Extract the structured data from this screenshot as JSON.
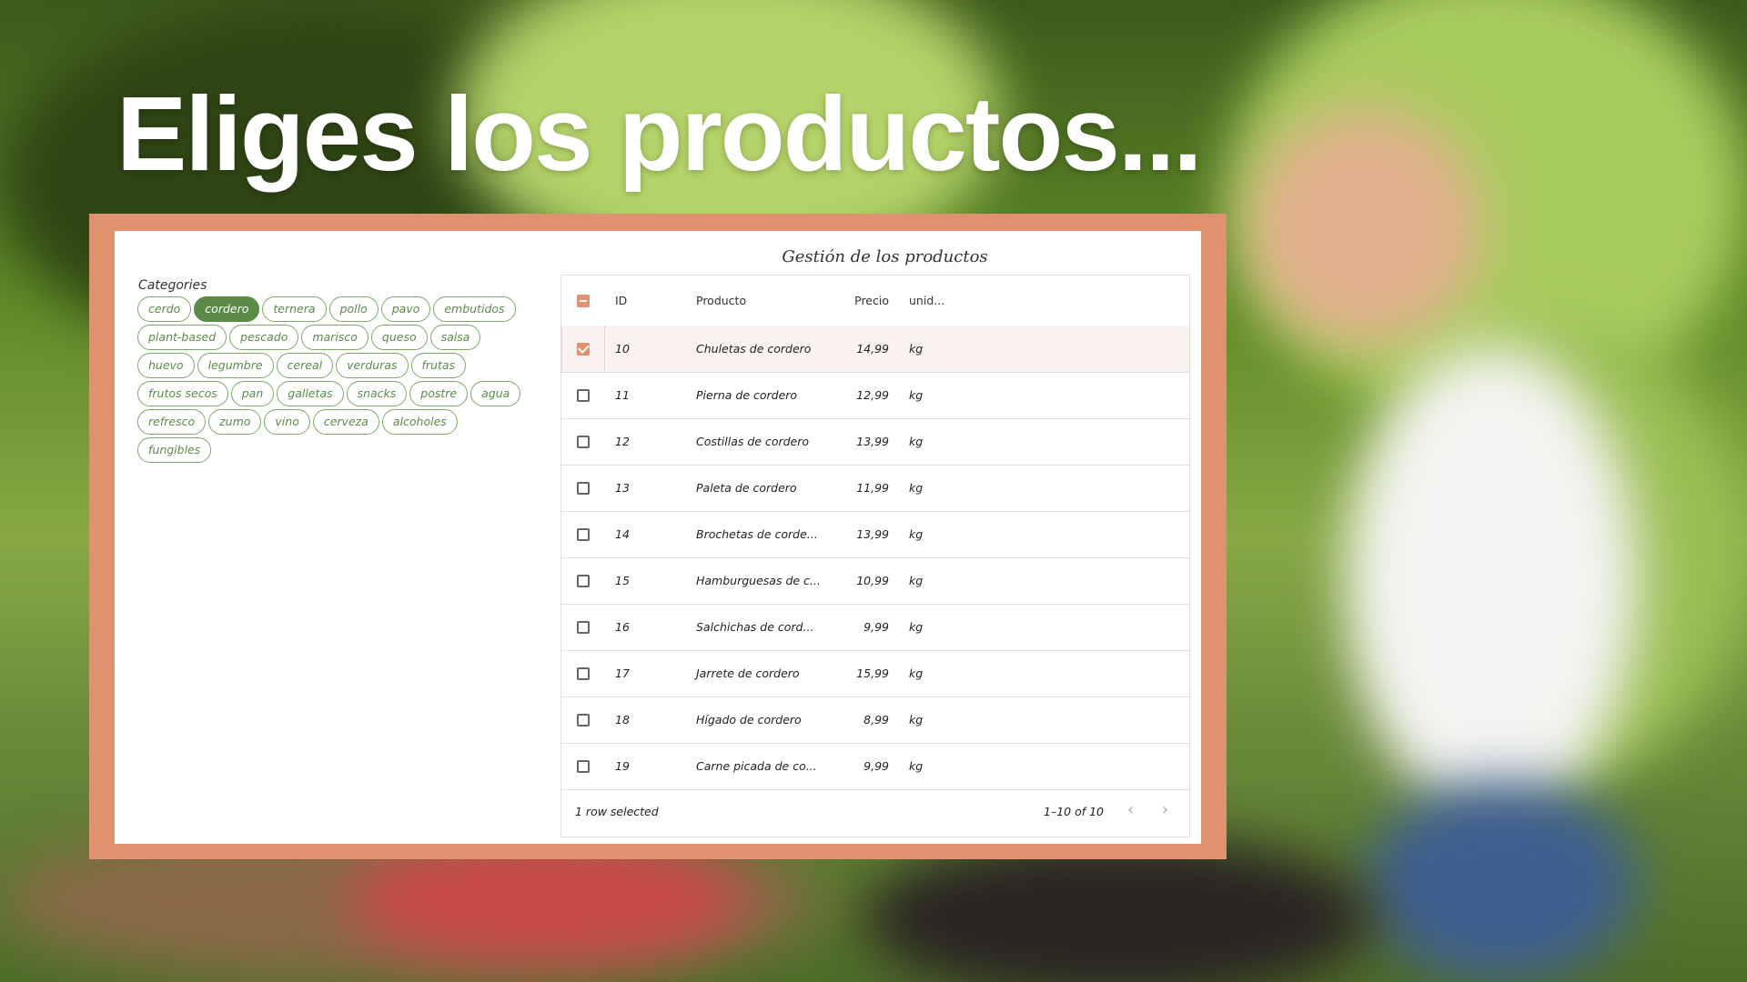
{
  "headline": "Eliges los productos...",
  "panel": {
    "title": "Gestión de los productos",
    "categories_label": "Categories",
    "categories": [
      {
        "label": "cerdo",
        "selected": false
      },
      {
        "label": "cordero",
        "selected": true
      },
      {
        "label": "ternera",
        "selected": false
      },
      {
        "label": "pollo",
        "selected": false
      },
      {
        "label": "pavo",
        "selected": false
      },
      {
        "label": "embutidos",
        "selected": false
      },
      {
        "label": "plant-based",
        "selected": false
      },
      {
        "label": "pescado",
        "selected": false
      },
      {
        "label": "marisco",
        "selected": false
      },
      {
        "label": "queso",
        "selected": false
      },
      {
        "label": "salsa",
        "selected": false
      },
      {
        "label": "huevo",
        "selected": false
      },
      {
        "label": "legumbre",
        "selected": false
      },
      {
        "label": "cereal",
        "selected": false
      },
      {
        "label": "verduras",
        "selected": false
      },
      {
        "label": "frutas",
        "selected": false
      },
      {
        "label": "frutos secos",
        "selected": false
      },
      {
        "label": "pan",
        "selected": false
      },
      {
        "label": "galletas",
        "selected": false
      },
      {
        "label": "snacks",
        "selected": false
      },
      {
        "label": "postre",
        "selected": false
      },
      {
        "label": "agua",
        "selected": false
      },
      {
        "label": "refresco",
        "selected": false
      },
      {
        "label": "zumo",
        "selected": false
      },
      {
        "label": "vino",
        "selected": false
      },
      {
        "label": "cerveza",
        "selected": false
      },
      {
        "label": "alcoholes",
        "selected": false
      },
      {
        "label": "fungibles",
        "selected": false
      }
    ]
  },
  "grid": {
    "columns": {
      "id": "ID",
      "product": "Producto",
      "price": "Precio",
      "unit": "unid..."
    },
    "rows": [
      {
        "id": "10",
        "product": "Chuletas de cordero",
        "price": "14,99",
        "unit": "kg",
        "checked": true
      },
      {
        "id": "11",
        "product": "Pierna de cordero",
        "price": "12,99",
        "unit": "kg",
        "checked": false
      },
      {
        "id": "12",
        "product": "Costillas de cordero",
        "price": "13,99",
        "unit": "kg",
        "checked": false
      },
      {
        "id": "13",
        "product": "Paleta de cordero",
        "price": "11,99",
        "unit": "kg",
        "checked": false
      },
      {
        "id": "14",
        "product": "Brochetas de corde...",
        "price": "13,99",
        "unit": "kg",
        "checked": false
      },
      {
        "id": "15",
        "product": "Hamburguesas de c...",
        "price": "10,99",
        "unit": "kg",
        "checked": false
      },
      {
        "id": "16",
        "product": "Salchichas de cord...",
        "price": "9,99",
        "unit": "kg",
        "checked": false
      },
      {
        "id": "17",
        "product": "Jarrete de cordero",
        "price": "15,99",
        "unit": "kg",
        "checked": false
      },
      {
        "id": "18",
        "product": "Hígado de cordero",
        "price": "8,99",
        "unit": "kg",
        "checked": false
      },
      {
        "id": "19",
        "product": "Carne picada de co...",
        "price": "9,99",
        "unit": "kg",
        "checked": false
      }
    ],
    "selected_text": "1 row selected",
    "pagination_text": "1–10 of 10",
    "prev_icon": "chevron-left-icon",
    "next_icon": "chevron-right-icon"
  },
  "colors": {
    "accent": "#e0916f",
    "chip_green": "#5c8a47"
  }
}
